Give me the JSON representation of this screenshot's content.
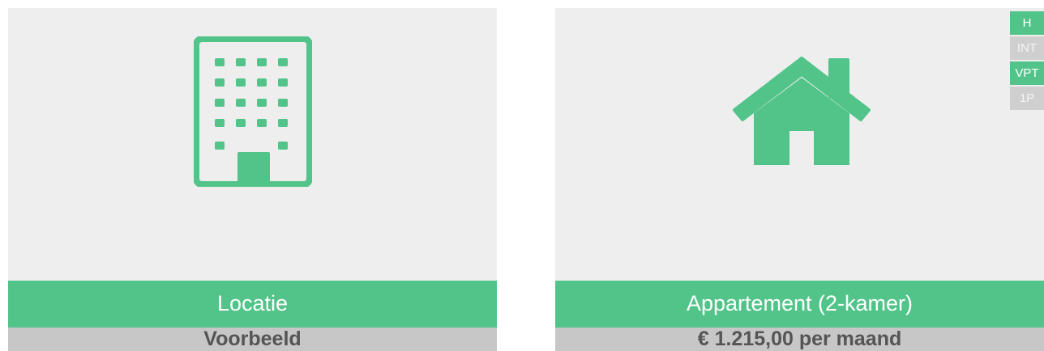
{
  "cards": [
    {
      "icon": "building-icon",
      "title": "Locatie",
      "subtitle": "Voorbeeld"
    },
    {
      "icon": "house-icon",
      "title": "Appartement (2-kamer)",
      "subtitle": "€ 1.215,00 per maand"
    }
  ],
  "tags": [
    {
      "label": "H",
      "active": true
    },
    {
      "label": "INT",
      "active": false
    },
    {
      "label": "VPT",
      "active": true
    },
    {
      "label": "1P",
      "active": false
    }
  ],
  "colors": {
    "accent": "#52c48a",
    "image_bg": "#eeeeee",
    "subtitle_bg": "#c7c7c7",
    "subtitle_text": "#555555",
    "tag_inactive": "#cfcfcf"
  }
}
